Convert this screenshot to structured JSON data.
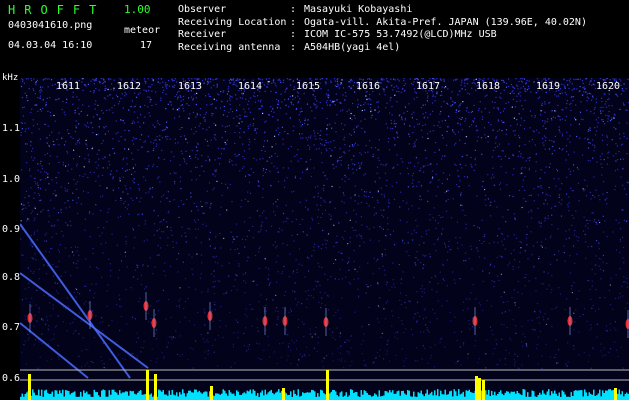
{
  "app": {
    "title": "HROFFT",
    "version": "1.00"
  },
  "capture": {
    "filename": "0403041610.png",
    "datetime": "04.03.04 16:10",
    "meteor_label": "meteor",
    "meteor_count": "17"
  },
  "station": {
    "rows": [
      {
        "label": "Observer",
        "value": "Masayuki Kobayashi"
      },
      {
        "label": "Receiving Location",
        "value": "Ogata-vill. Akita-Pref. JAPAN (139.96E, 40.02N)"
      },
      {
        "label": "Receiver",
        "value": "ICOM IC-575 53.7492(@LCD)MHz USB"
      },
      {
        "label": "Receiving antenna",
        "value": "A504HB(yagi 4el)"
      }
    ],
    "separator": ":"
  },
  "spectrogram": {
    "y_unit": "kHz",
    "time_ticks": [
      "1611",
      "1612",
      "1613",
      "1614",
      "1615",
      "1616",
      "1617",
      "1618",
      "1619",
      "1620"
    ],
    "freq_ticks": [
      "1.1",
      "1.0",
      "0.9",
      "0.8",
      "0.7",
      "0.6"
    ],
    "colors": {
      "background": "#000028",
      "noise": "#3030c8",
      "echo": "#ff3030",
      "histogram": "#ffff00",
      "baseline": "#00e0ff"
    }
  }
}
